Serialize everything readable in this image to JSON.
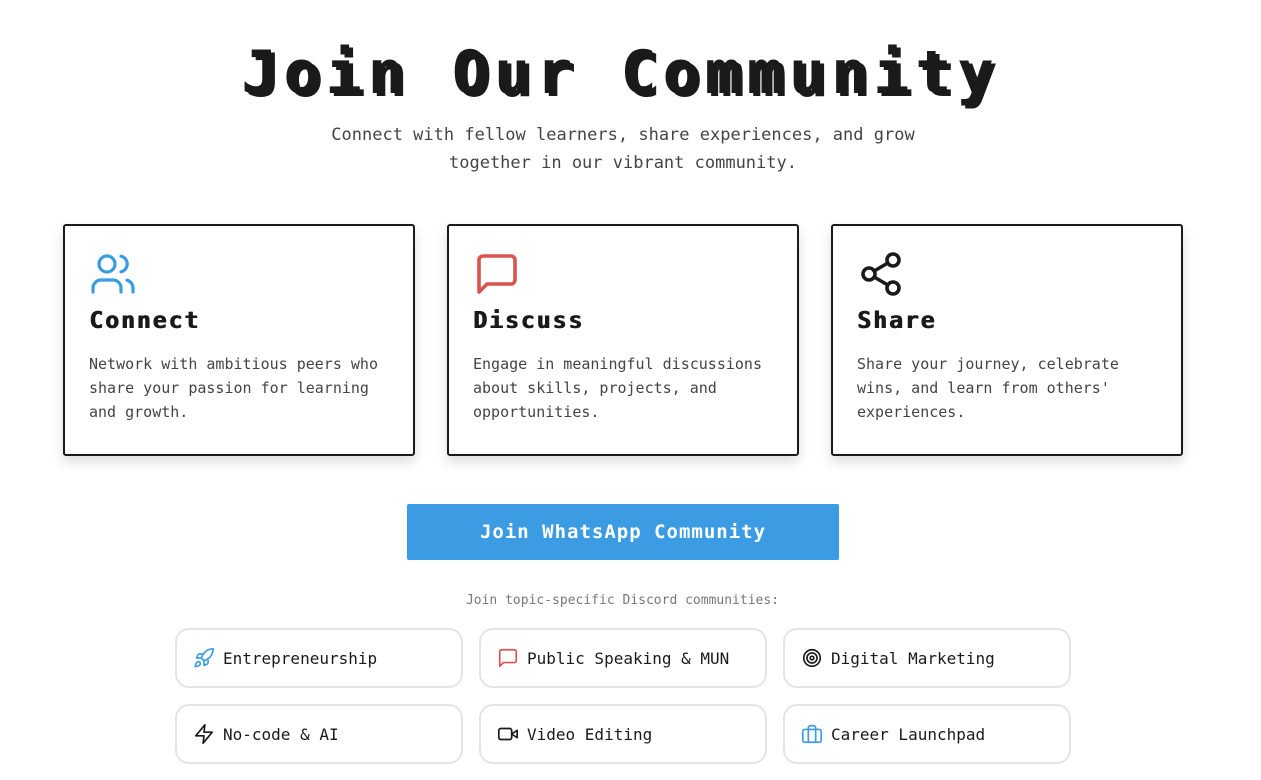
{
  "heading": {
    "title": "Join Our Community",
    "subtitle": "Connect with fellow learners, share experiences, and grow together in our vibrant community."
  },
  "features": [
    {
      "icon": "users-icon",
      "color": "#3b9be3",
      "title": "Connect",
      "text": "Network with ambitious peers who share your passion for learning and growth."
    },
    {
      "icon": "message-square-icon",
      "color": "#d9534f",
      "title": "Discuss",
      "text": "Engage in meaningful discussions about skills, projects, and opportunities."
    },
    {
      "icon": "share-icon",
      "color": "#1a1a1a",
      "title": "Share",
      "text": "Share your journey, celebrate wins, and learn from others' experiences."
    }
  ],
  "cta": {
    "label": "Join WhatsApp Community",
    "color": "#3b9be3"
  },
  "discord": {
    "label": "Join topic-specific Discord communities:",
    "communities": [
      {
        "label": "Entrepreneurship",
        "icon": "rocket-icon",
        "color": "#3b9be3"
      },
      {
        "label": "Public Speaking & MUN",
        "icon": "message-square-icon",
        "color": "#d9534f"
      },
      {
        "label": "Digital Marketing",
        "icon": "target-icon",
        "color": "#1a1a1a"
      },
      {
        "label": "No-code & AI",
        "icon": "zap-icon",
        "color": "#1a1a1a"
      },
      {
        "label": "Video Editing",
        "icon": "video-icon",
        "color": "#1a1a1a"
      },
      {
        "label": "Career Launchpad",
        "icon": "briefcase-icon",
        "color": "#3b9be3"
      }
    ]
  }
}
